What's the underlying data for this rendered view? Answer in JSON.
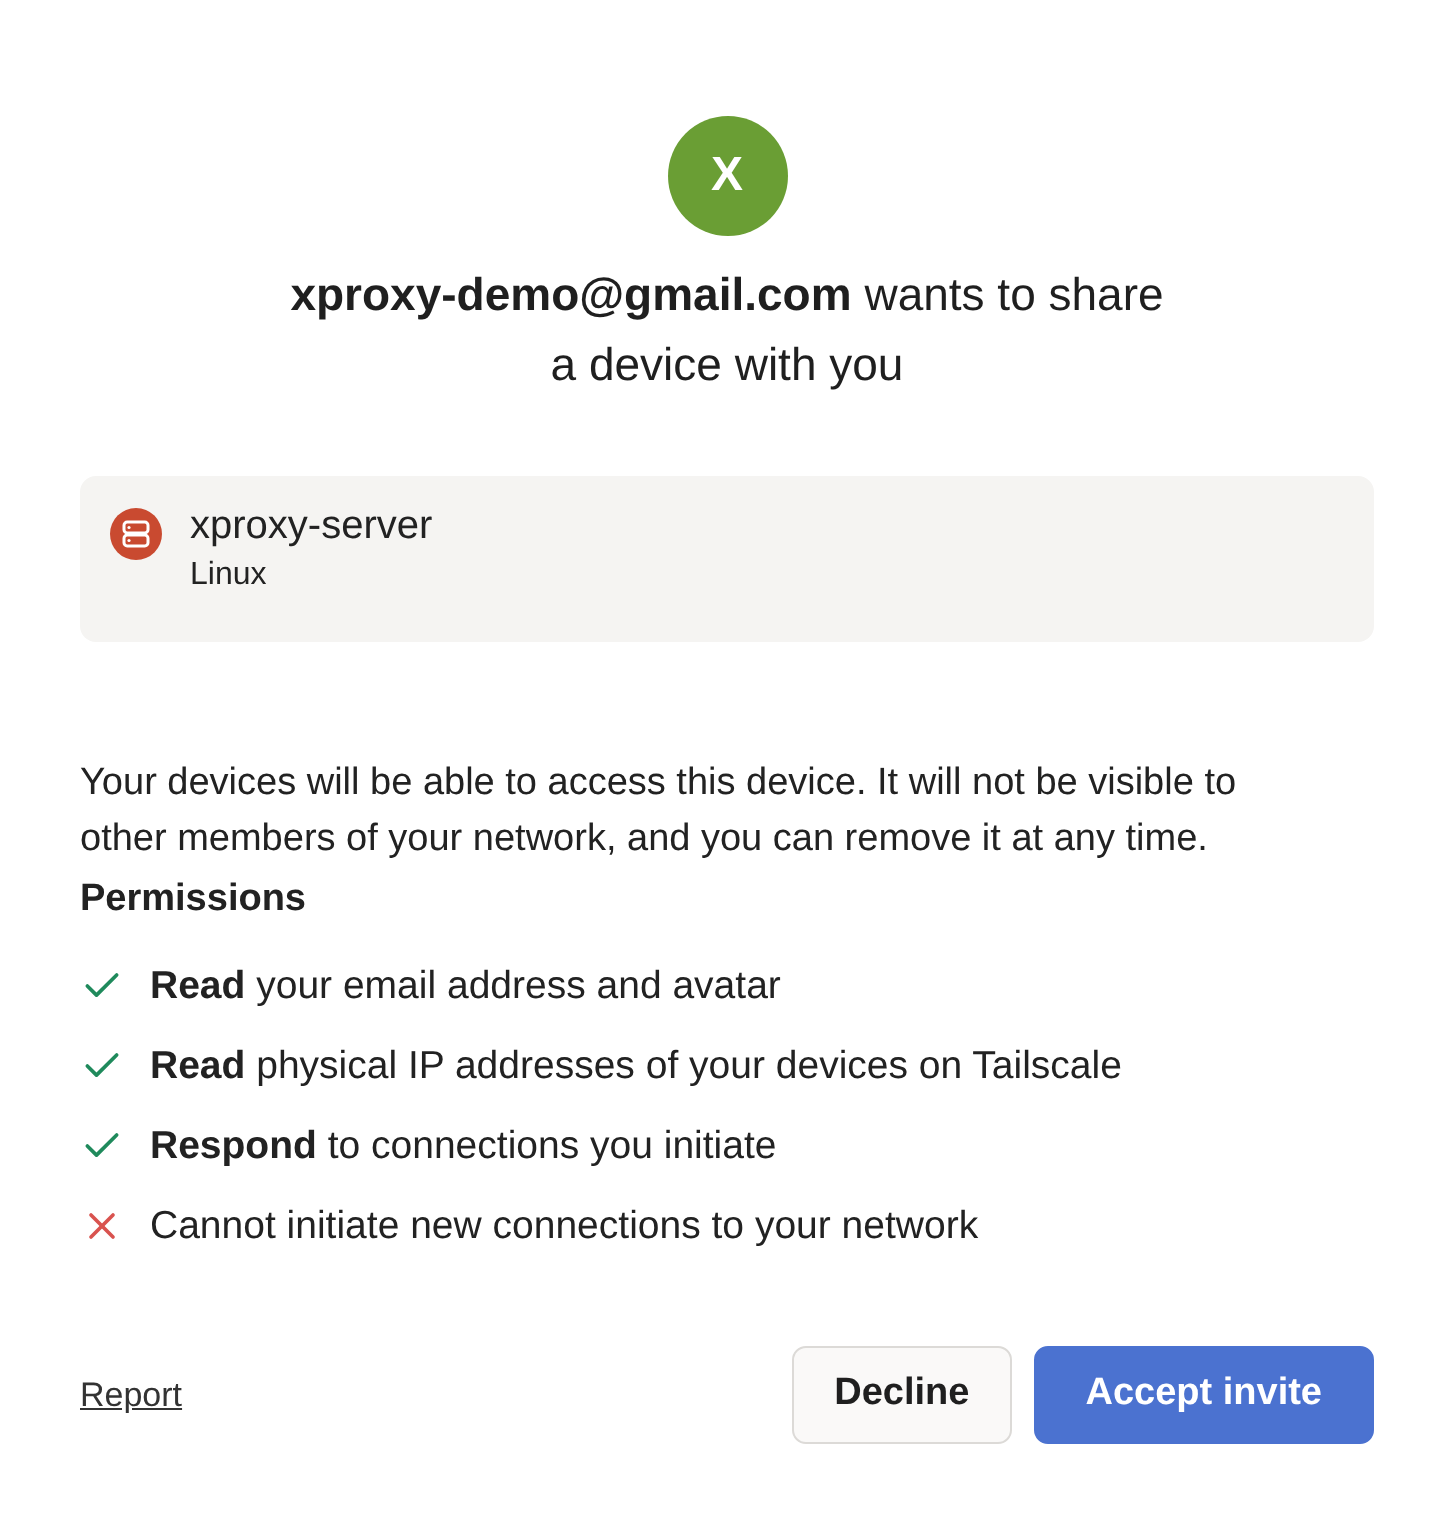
{
  "avatar": {
    "initial": "X"
  },
  "heading": "**xproxy-demo@gmail.com** wants to share a device with you",
  "device": {
    "name": "xproxy-server",
    "os": "Linux"
  },
  "description": "Your devices will be able to access this device. It will not be visible to other members of your network, and you can remove it at any time.",
  "permissions": {
    "title": "Permissions",
    "items": [
      {
        "kind": "allowed",
        "text": "**Read** your email address and avatar"
      },
      {
        "kind": "allowed",
        "text": "**Read** physical IP addresses of your devices on Tailscale"
      },
      {
        "kind": "allowed",
        "text": "**Respond** to connections you initiate"
      },
      {
        "kind": "denied",
        "text": "Cannot initiate new connections to your network"
      }
    ]
  },
  "footer": {
    "report_link": "Report",
    "buttons": [
      {
        "kind": "secondary",
        "label": "Decline"
      },
      {
        "kind": "primary",
        "label": "Accept invite"
      }
    ]
  }
}
